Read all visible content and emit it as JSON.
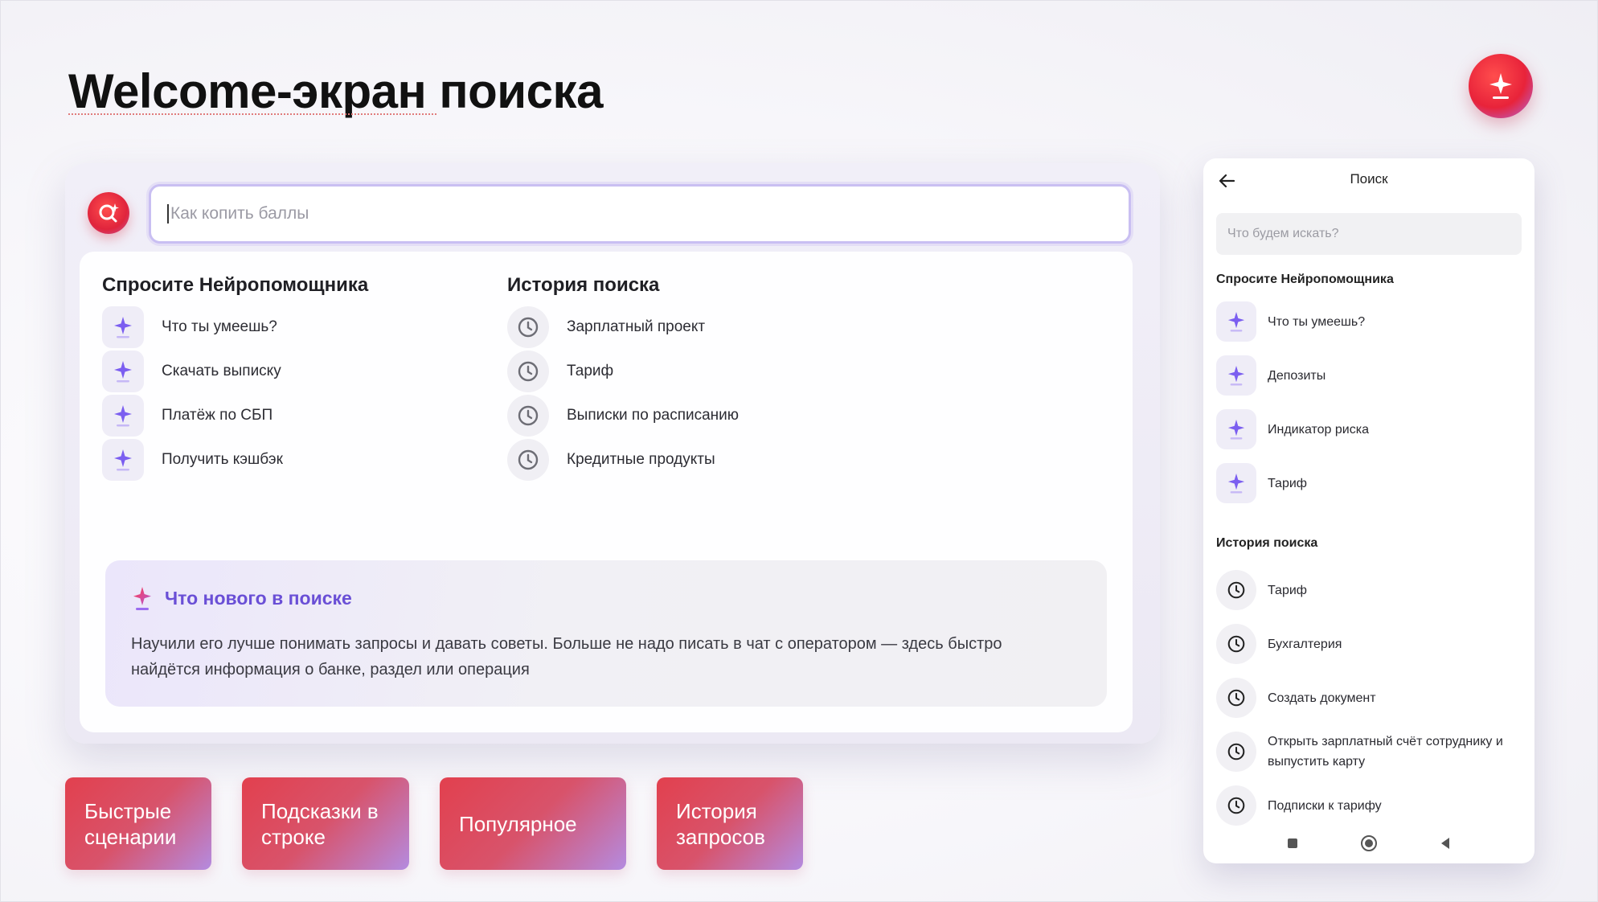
{
  "page": {
    "title": "Welcome-экран поиска",
    "accent": "#e2404e",
    "brand_violet": "#6a4fd6"
  },
  "desktop": {
    "search": {
      "value": "",
      "placeholder": "Как копить баллы"
    },
    "assistant": {
      "title": "Спросите Нейропомощника",
      "icon": "sparkle-icon",
      "items": [
        {
          "label": "Что ты умеешь?"
        },
        {
          "label": "Скачать выписку"
        },
        {
          "label": "Платёж по СБП"
        },
        {
          "label": "Получить кэшбэк"
        }
      ]
    },
    "history": {
      "title": "История поиска",
      "icon": "clock-icon",
      "items": [
        {
          "label": "Зарплатный проект"
        },
        {
          "label": "Тариф"
        },
        {
          "label": "Выписки по расписанию"
        },
        {
          "label": "Кредитные продукты"
        }
      ]
    },
    "news": {
      "title": "Что нового в поиске",
      "body": "Научили его лучше понимать запросы и давать советы. Больше не надо писать в чат с оператором — здесь быстро найдётся информация о банке, раздел или операция"
    }
  },
  "tiles": [
    {
      "label": "Быстрые сценарии"
    },
    {
      "label": "Подсказки в строке"
    },
    {
      "label": "Популярное"
    },
    {
      "label": "История запросов"
    }
  ],
  "mobile": {
    "title": "Поиск",
    "back_icon": "arrow-left-icon",
    "search": {
      "value": "",
      "placeholder": "Что будем искать?"
    },
    "assistant": {
      "title": "Спросите Нейропомощника",
      "items": [
        {
          "label": "Что ты умеешь?"
        },
        {
          "label": "Депозиты"
        },
        {
          "label": "Индикатор риска"
        },
        {
          "label": "Тариф"
        }
      ]
    },
    "history": {
      "title": "История поиска",
      "items": [
        {
          "label": "Тариф"
        },
        {
          "label": "Бухгалтерия"
        },
        {
          "label": "Создать документ"
        },
        {
          "label": "Открыть зарплатный счёт сотруднику и выпустить карту"
        },
        {
          "label": "Подписки к тарифу"
        }
      ]
    },
    "nav": [
      "square-recents-icon",
      "circle-home-icon",
      "triangle-back-icon"
    ]
  }
}
